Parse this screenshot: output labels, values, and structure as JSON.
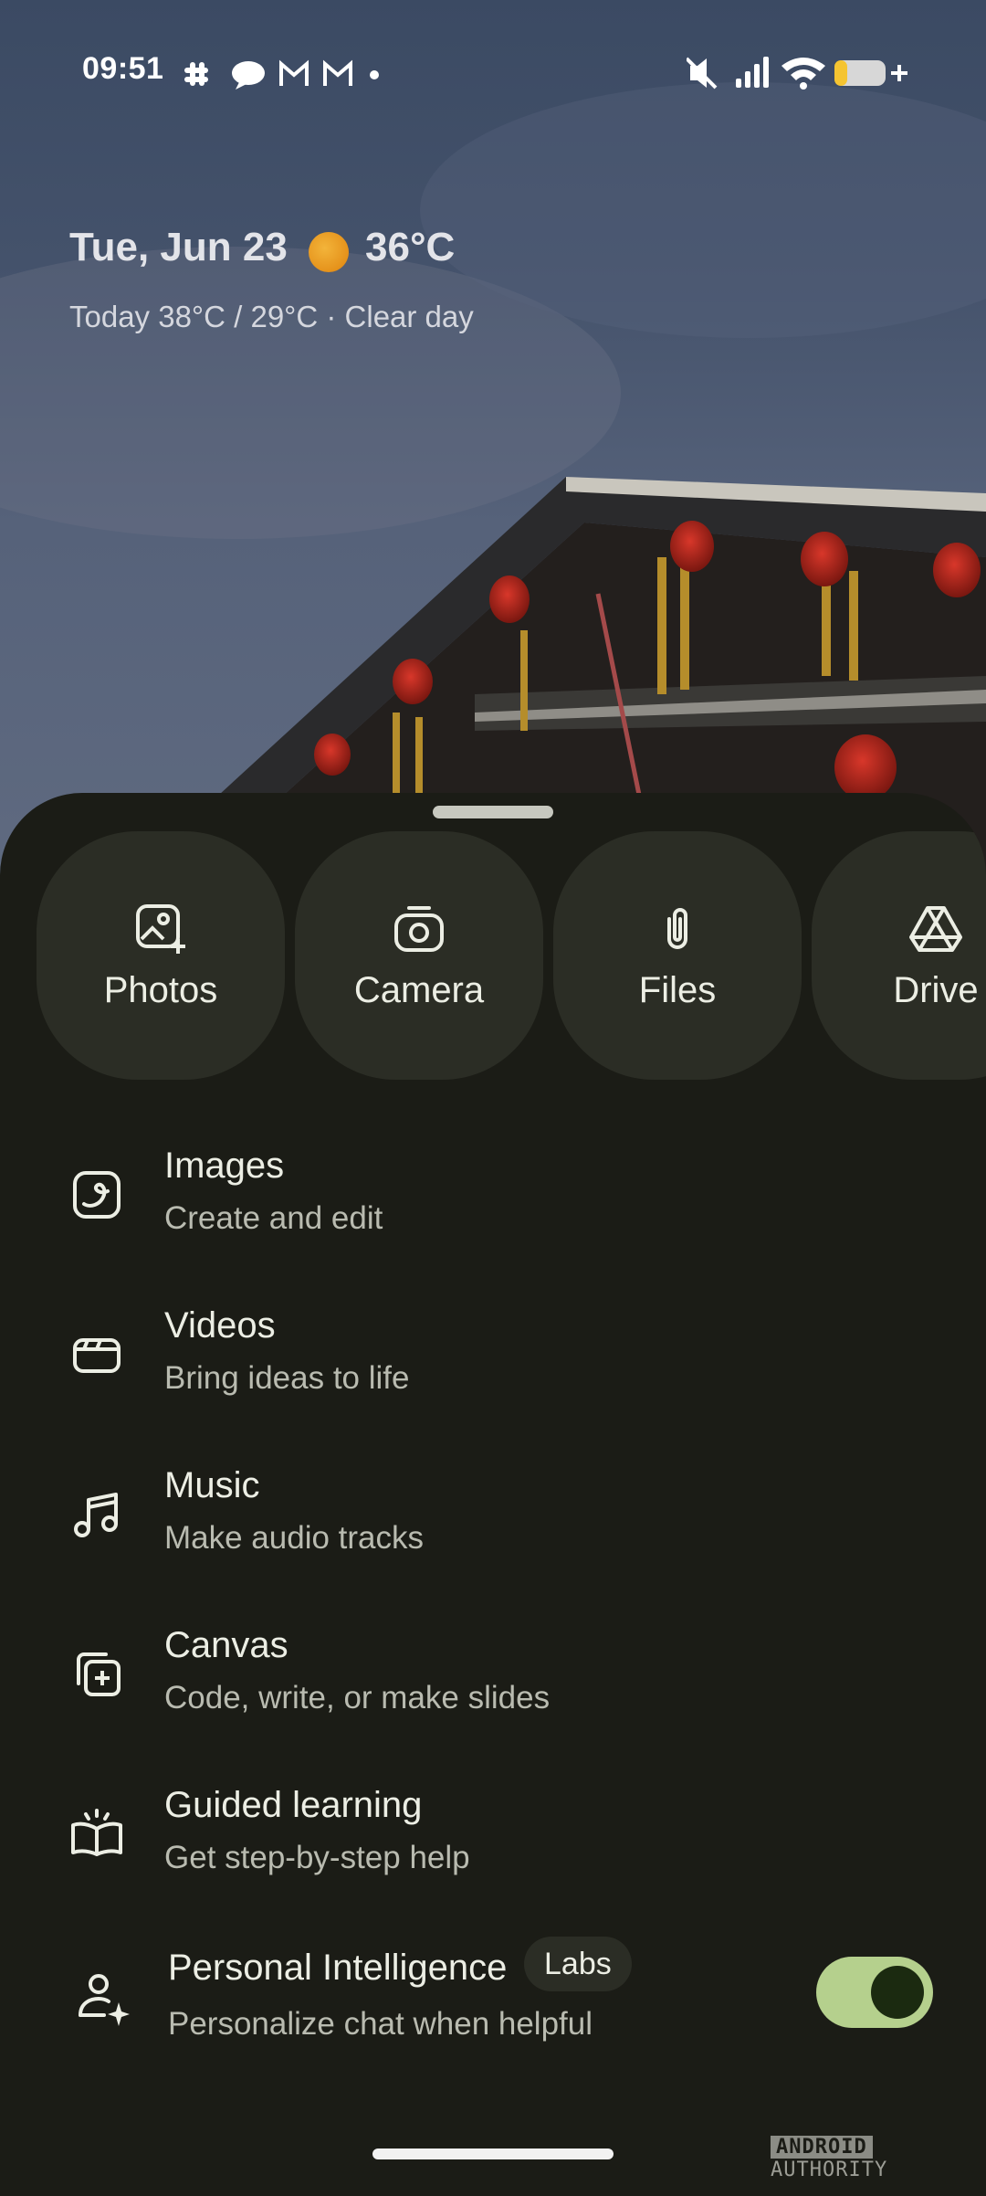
{
  "status_bar": {
    "time": "09:51",
    "notification_icons": [
      "slack-icon",
      "messages-icon",
      "gmail-icon",
      "gmail-icon",
      "more-dot-icon"
    ],
    "right_icons": [
      "mute-icon",
      "signal-icon",
      "wifi-icon",
      "battery-icon"
    ],
    "battery_level": 0.2,
    "battery_color": "#f5c431"
  },
  "weather": {
    "date": "Tue, Jun 23",
    "temperature": "36°C",
    "forecast": "Today 38°C / 29°C · Clear day",
    "icon": "sun-icon"
  },
  "attach_tiles": [
    {
      "label": "Photos",
      "icon": "photo-add-icon"
    },
    {
      "label": "Camera",
      "icon": "camera-icon"
    },
    {
      "label": "Files",
      "icon": "paperclip-icon"
    },
    {
      "label": "Drive",
      "icon": "drive-icon"
    }
  ],
  "features": [
    {
      "title": "Images",
      "subtitle": "Create and edit",
      "icon": "image-edit-icon"
    },
    {
      "title": "Videos",
      "subtitle": "Bring ideas to life",
      "icon": "clapperboard-icon"
    },
    {
      "title": "Music",
      "subtitle": "Make audio tracks",
      "icon": "music-note-icon"
    },
    {
      "title": "Canvas",
      "subtitle": "Code, write, or make slides",
      "icon": "canvas-add-icon"
    },
    {
      "title": "Guided learning",
      "subtitle": "Get step-by-step help",
      "icon": "open-book-icon"
    }
  ],
  "personal_intelligence": {
    "title": "Personal Intelligence",
    "badge": "Labs",
    "subtitle": "Personalize chat when helpful",
    "icon": "person-sparkle-icon",
    "toggle_on": true,
    "toggle_color": "#b5d08d"
  },
  "watermark": {
    "brand": "ANDROID",
    "suffix": "AUTHORITY"
  },
  "colors": {
    "sheet_background": "#1b1c16",
    "tile_background": "#2b2d25",
    "primary_text": "#eceee4",
    "secondary_text": "#b9bbb0"
  }
}
